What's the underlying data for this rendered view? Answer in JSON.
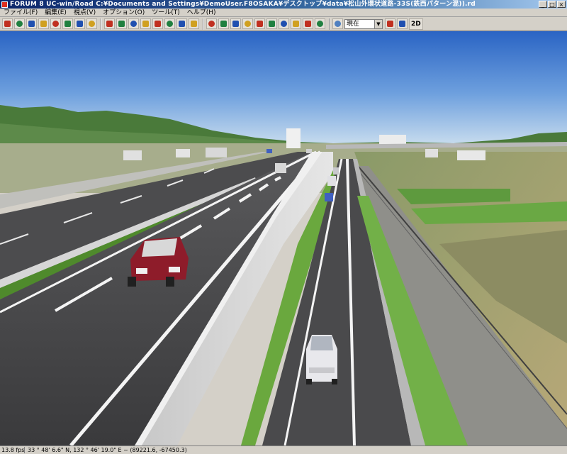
{
  "window": {
    "title": "FORUM 8    UC-win/Road    C:¥Documents and Settings¥DemoUser.F8OSAKA¥デスクトップ¥data¥松山外環状道路-33S(鉄西パターン混)).rd",
    "minimize": "_",
    "maximize": "□",
    "close": "×"
  },
  "menu": {
    "items": [
      "ファイル(F)",
      "編集(E)",
      "視点(V)",
      "オプション(O)",
      "ツール(T)",
      "ヘルプ(H)"
    ]
  },
  "toolbar": {
    "time_select": "現在",
    "view_2d": "2D",
    "icons": [
      "pen-icon",
      "grid-icon",
      "map-icon",
      "road-icon",
      "person-icon",
      "tree-icon",
      "list-icon",
      "book-icon",
      "scene-icon",
      "cursor-icon",
      "flag-icon",
      "rotate-icon",
      "paint-icon",
      "recycle-icon",
      "globe-icon",
      "heart-icon",
      "target-icon",
      "walk-icon",
      "move-icon",
      "zoom-icon",
      "circle-icon",
      "drive-icon",
      "pause-icon",
      "stop-icon",
      "car-icon",
      "camera-icon",
      "clock-icon",
      "shield-icon",
      "flag2-icon"
    ],
    "accent_colors": [
      "#c03020",
      "#208040",
      "#2050b0",
      "#d0a020"
    ]
  },
  "status": {
    "fps": "13.8 fps",
    "coords": "33 ° 48' 6.6\" N, 132 ° 46' 19.0\" E  ~  (89221.6, -67450.3)"
  }
}
